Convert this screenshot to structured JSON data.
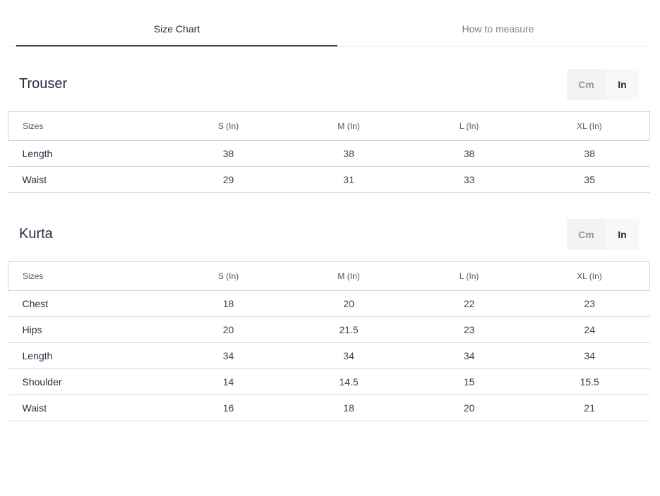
{
  "tabs": [
    {
      "label": "Size Chart",
      "active": true
    },
    {
      "label": "How to measure",
      "active": false
    }
  ],
  "units": {
    "cm": "Cm",
    "in": "In"
  },
  "trouser": {
    "title": "Trouser",
    "headers": [
      "Sizes",
      "S (In)",
      "M (In)",
      "L (In)",
      "XL (In)"
    ],
    "rows": [
      [
        "Length",
        "38",
        "38",
        "38",
        "38"
      ],
      [
        "Waist",
        "29",
        "31",
        "33",
        "35"
      ]
    ]
  },
  "kurta": {
    "title": "Kurta",
    "headers": [
      "Sizes",
      "S (In)",
      "M (In)",
      "L (In)",
      "XL (In)"
    ],
    "rows": [
      [
        "Chest",
        "18",
        "20",
        "22",
        "23"
      ],
      [
        "Hips",
        "20",
        "21.5",
        "23",
        "24"
      ],
      [
        "Length",
        "34",
        "34",
        "34",
        "34"
      ],
      [
        "Shoulder",
        "14",
        "14.5",
        "15",
        "15.5"
      ],
      [
        "Waist",
        "16",
        "18",
        "20",
        "21"
      ]
    ]
  }
}
